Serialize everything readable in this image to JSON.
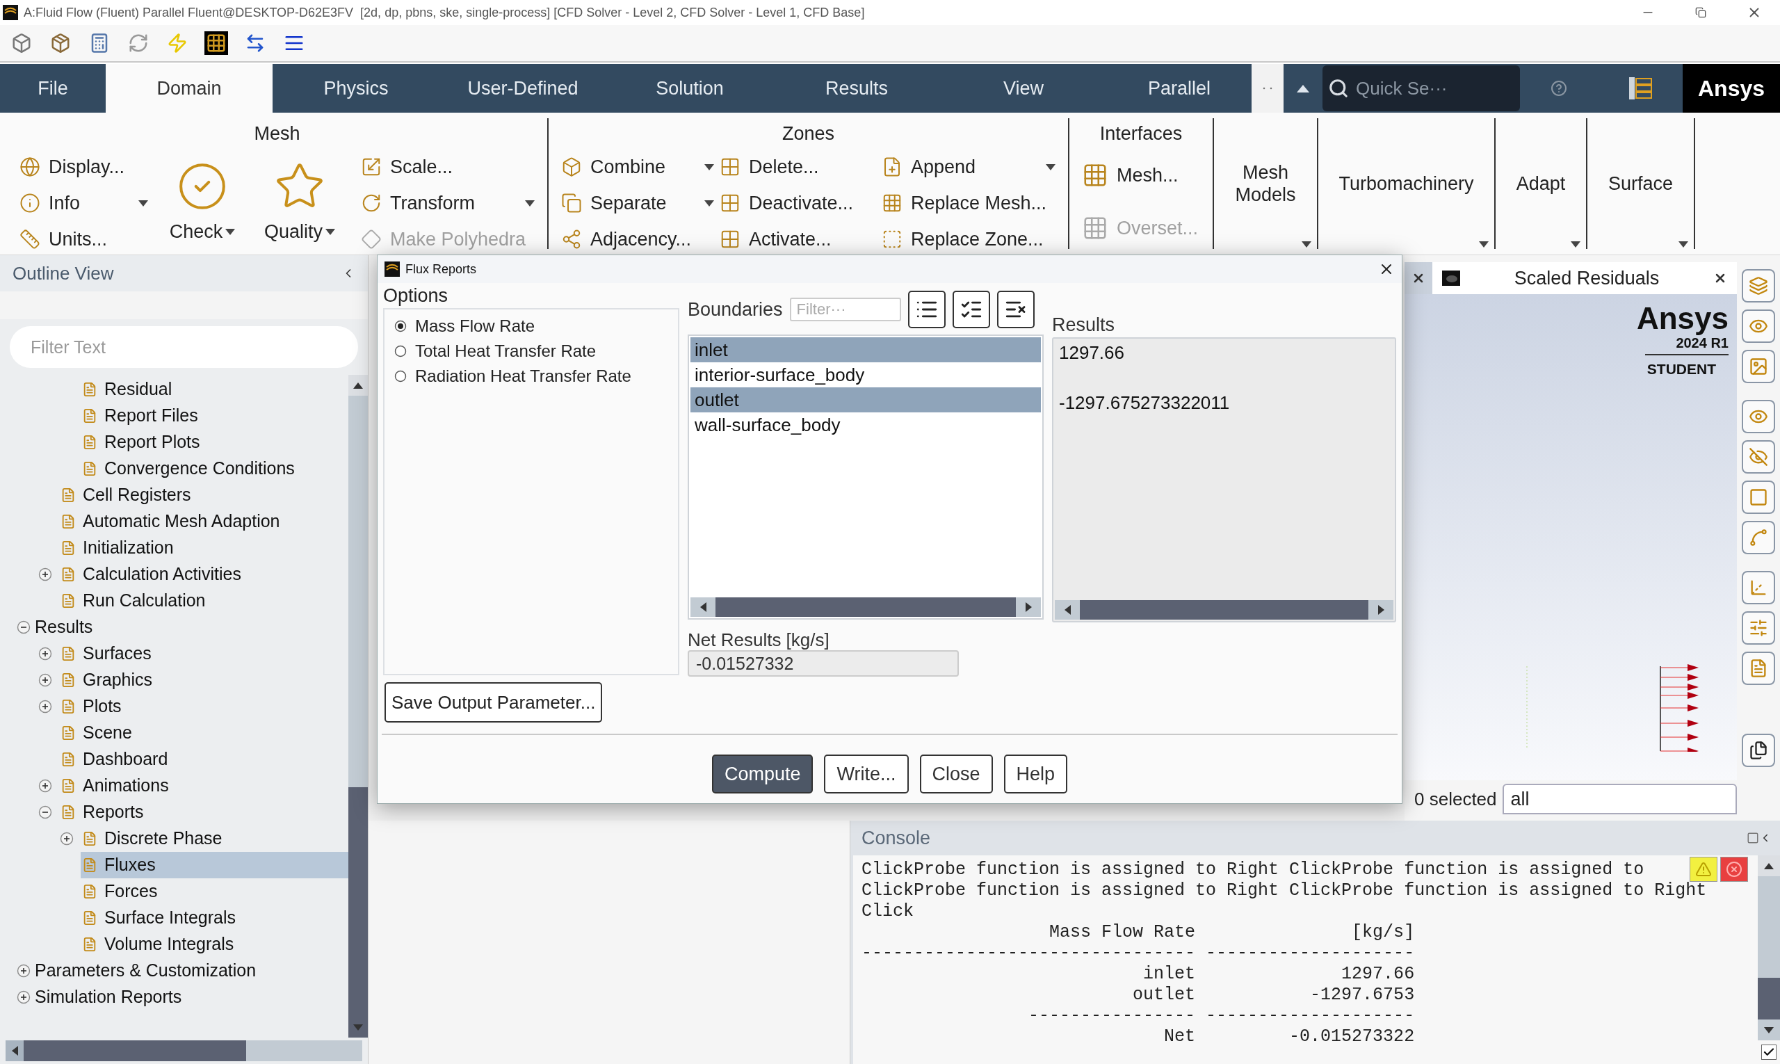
{
  "window": {
    "title": "A:Fluid Flow (Fluent) Parallel Fluent@DESKTOP-D62E3FV  [2d, dp, pbns, ske, single-process] [CFD Solver - Level 2, CFD Solver - Level 1, CFD Base]"
  },
  "tabs": [
    {
      "label": "File",
      "selected": false
    },
    {
      "label": "Domain",
      "selected": true
    },
    {
      "label": "Physics",
      "selected": false
    },
    {
      "label": "User-Defined",
      "selected": false
    },
    {
      "label": "Solution",
      "selected": false
    },
    {
      "label": "Results",
      "selected": false
    },
    {
      "label": "View",
      "selected": false
    },
    {
      "label": "Parallel",
      "selected": false
    }
  ],
  "search": {
    "placeholder": "Quick Se···"
  },
  "brand": "Ansys",
  "ribbon": {
    "groups": [
      {
        "kind": "panel",
        "title": "Mesh",
        "columns": [
          {
            "kind": "small",
            "items": [
              {
                "label": "Display...",
                "disabled": false,
                "caret": false
              },
              {
                "label": "Info",
                "disabled": false,
                "caret": true
              },
              {
                "label": "Units...",
                "disabled": false,
                "caret": false
              }
            ]
          },
          {
            "kind": "large",
            "items": [
              {
                "label": "Check",
                "disabled": false,
                "caret": true
              },
              {
                "label": "Quality",
                "disabled": false,
                "caret": true
              }
            ]
          },
          {
            "kind": "small",
            "items": [
              {
                "label": "Scale...",
                "disabled": false,
                "caret": false
              },
              {
                "label": "Transform",
                "disabled": false,
                "caret": true
              },
              {
                "label": "Make Polyhedra",
                "disabled": true,
                "caret": false
              }
            ]
          }
        ]
      },
      {
        "kind": "panel",
        "title": "Zones",
        "columns": [
          {
            "kind": "small",
            "items": [
              {
                "label": "Combine",
                "disabled": false,
                "caret": true
              },
              {
                "label": "Separate",
                "disabled": false,
                "caret": true
              },
              {
                "label": "Adjacency...",
                "disabled": false,
                "caret": false
              }
            ]
          },
          {
            "kind": "small",
            "items": [
              {
                "label": "Delete...",
                "disabled": false,
                "caret": false
              },
              {
                "label": "Deactivate...",
                "disabled": false,
                "caret": false
              },
              {
                "label": "Activate...",
                "disabled": false,
                "caret": false
              }
            ]
          },
          {
            "kind": "small",
            "items": [
              {
                "label": "Append",
                "disabled": false,
                "caret": true
              },
              {
                "label": "Replace Mesh...",
                "disabled": false,
                "caret": false
              },
              {
                "label": "Replace Zone...",
                "disabled": false,
                "caret": false
              }
            ]
          }
        ]
      },
      {
        "kind": "panel",
        "title": "Interfaces",
        "columns": [
          {
            "kind": "medium",
            "items": [
              {
                "label": "Mesh...",
                "disabled": false,
                "caret": false
              },
              {
                "label": "Overset...",
                "disabled": true,
                "caret": false
              }
            ]
          }
        ]
      },
      {
        "kind": "menu",
        "label": "Mesh Models",
        "caret": true
      },
      {
        "kind": "menu",
        "label": "Turbomachinery",
        "caret": true
      },
      {
        "kind": "menu",
        "label": "Adapt",
        "caret": true
      },
      {
        "kind": "menu",
        "label": "Surface",
        "caret": true
      }
    ]
  },
  "outline": {
    "title": "Outline View",
    "filter": {
      "placeholder": "Filter Text"
    },
    "tree": [
      {
        "children": [
          {
            "children": [
              {
                "label": "Residual",
                "selected": false
              },
              {
                "label": "Report Files",
                "selected": false
              },
              {
                "label": "Report Plots",
                "selected": false
              },
              {
                "label": "Convergence Conditions",
                "selected": false
              }
            ]
          },
          {
            "label": "Cell Registers",
            "selected": false
          },
          {
            "label": "Automatic Mesh Adaption",
            "selected": false
          },
          {
            "label": "Initialization",
            "selected": false
          },
          {
            "label": "Calculation Activities",
            "selected": false,
            "expanded": false
          },
          {
            "label": "Run Calculation",
            "selected": false
          }
        ]
      },
      {
        "label": "Results",
        "selected": false,
        "expanded": true,
        "children": [
          {
            "label": "Surfaces",
            "selected": false,
            "expanded": false
          },
          {
            "label": "Graphics",
            "selected": false,
            "expanded": false
          },
          {
            "label": "Plots",
            "selected": false,
            "expanded": false
          },
          {
            "label": "Scene",
            "selected": false
          },
          {
            "label": "Dashboard",
            "selected": false
          },
          {
            "label": "Animations",
            "selected": false,
            "expanded": false
          },
          {
            "label": "Reports",
            "selected": false,
            "expanded": true,
            "children": [
              {
                "label": "Discrete Phase",
                "selected": false,
                "expanded": false
              },
              {
                "label": "Fluxes",
                "selected": true
              },
              {
                "label": "Forces",
                "selected": false
              },
              {
                "label": "Surface Integrals",
                "selected": false
              },
              {
                "label": "Volume Integrals",
                "selected": false
              }
            ]
          }
        ]
      },
      {
        "label": "Parameters & Customization",
        "selected": false,
        "expanded": false
      },
      {
        "label": "Simulation Reports",
        "selected": false,
        "expanded": false
      }
    ]
  },
  "dialog": {
    "title": "Flux Reports",
    "options_label": "Options",
    "options": [
      {
        "label": "Mass Flow Rate",
        "selected": true
      },
      {
        "label": "Total Heat Transfer Rate",
        "selected": false
      },
      {
        "label": "Radiation Heat Transfer Rate",
        "selected": false
      }
    ],
    "boundaries_label": "Boundaries",
    "filter": {
      "placeholder": "Filter···"
    },
    "boundaries": [
      {
        "name": "inlet",
        "selected": true,
        "result": "1297.66"
      },
      {
        "name": "interior-surface_body",
        "selected": false
      },
      {
        "name": "outlet",
        "selected": true,
        "result": "-1297.675273322011"
      },
      {
        "name": "wall-surface_body",
        "selected": false
      }
    ],
    "results_label": "Results",
    "net_label": "Net Results [kg/s]",
    "net_value": "-0.01527332",
    "save_button": "Save Output Parameter...",
    "buttons": [
      {
        "label": "Compute",
        "primary": true
      },
      {
        "label": "Write...",
        "primary": false
      },
      {
        "label": "Close",
        "primary": false
      },
      {
        "label": "Help",
        "primary": false
      }
    ]
  },
  "graphics": {
    "tab": "Scaled Residuals",
    "logo": {
      "brand": "Ansys",
      "version": "2024 R1",
      "edition": "STUDENT"
    },
    "selection": {
      "count": "0 selected",
      "filter": "all"
    }
  },
  "console": {
    "title": "Console",
    "checkbox": {
      "checked": true
    },
    "lines": [
      "ClickProbe function is assigned to Right ClickProbe function is assigned to",
      "ClickProbe function is assigned to Right ClickProbe function is assigned to Right",
      "Click",
      "                  Mass Flow Rate               [kg/s]",
      "-------------------------------- --------------------",
      "                           inlet              1297.66",
      "                          outlet           -1297.6753",
      "                ---------------- --------------------",
      "                             Net         -0.015273322"
    ]
  }
}
